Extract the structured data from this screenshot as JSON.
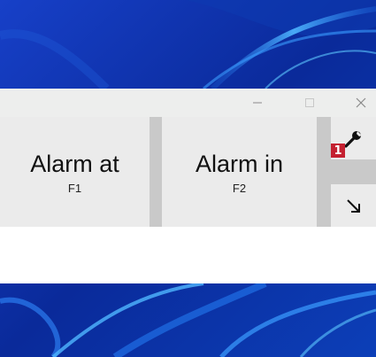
{
  "window": {
    "controls": {
      "minimize_icon": "minimize-icon",
      "maximize_icon": "maximize-icon",
      "close_icon": "close-icon"
    }
  },
  "buttons": [
    {
      "label": "Alarm at",
      "shortcut": "F1"
    },
    {
      "label": "Alarm in",
      "shortcut": "F2"
    }
  ],
  "settings": {
    "icon": "wrench-icon",
    "badge": "1"
  },
  "expand": {
    "icon": "arrow-down-right-icon"
  },
  "colors": {
    "titlebar": "#edeeed",
    "button_bg": "#ebebeb",
    "divider": "#c9c9c9",
    "badge": "#c42030",
    "wallpaper": "#0a2a9a"
  }
}
